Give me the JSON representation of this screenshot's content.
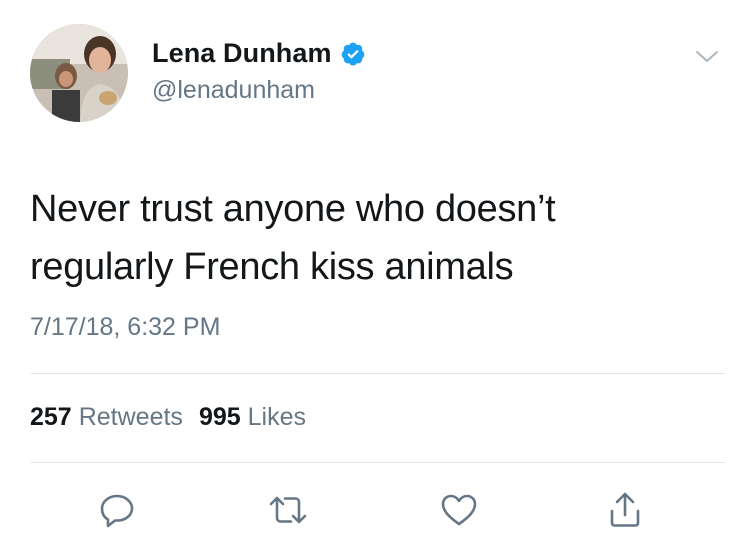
{
  "user": {
    "display_name": "Lena Dunham",
    "handle": "@lenadunham",
    "verified": true,
    "avatar_alt": "profile photo"
  },
  "tweet": {
    "text_line1": "Never trust anyone who doesn’t",
    "text_line2": "regularly French kiss animals",
    "timestamp": "7/17/18, 6:32 PM"
  },
  "stats": {
    "retweets_count": "257",
    "retweets_label": "Retweets",
    "likes_count": "995",
    "likes_label": "Likes"
  },
  "icons": {
    "reply": "reply-icon",
    "retweet": "retweet-icon",
    "like": "heart-icon",
    "share": "share-icon",
    "menu": "chevron-down-icon",
    "verified": "verified-badge-icon"
  },
  "colors": {
    "text": "#14171a",
    "secondary": "#657786",
    "verified": "#1da1f2",
    "divider": "#e1e8ed",
    "icon": "#657786"
  }
}
